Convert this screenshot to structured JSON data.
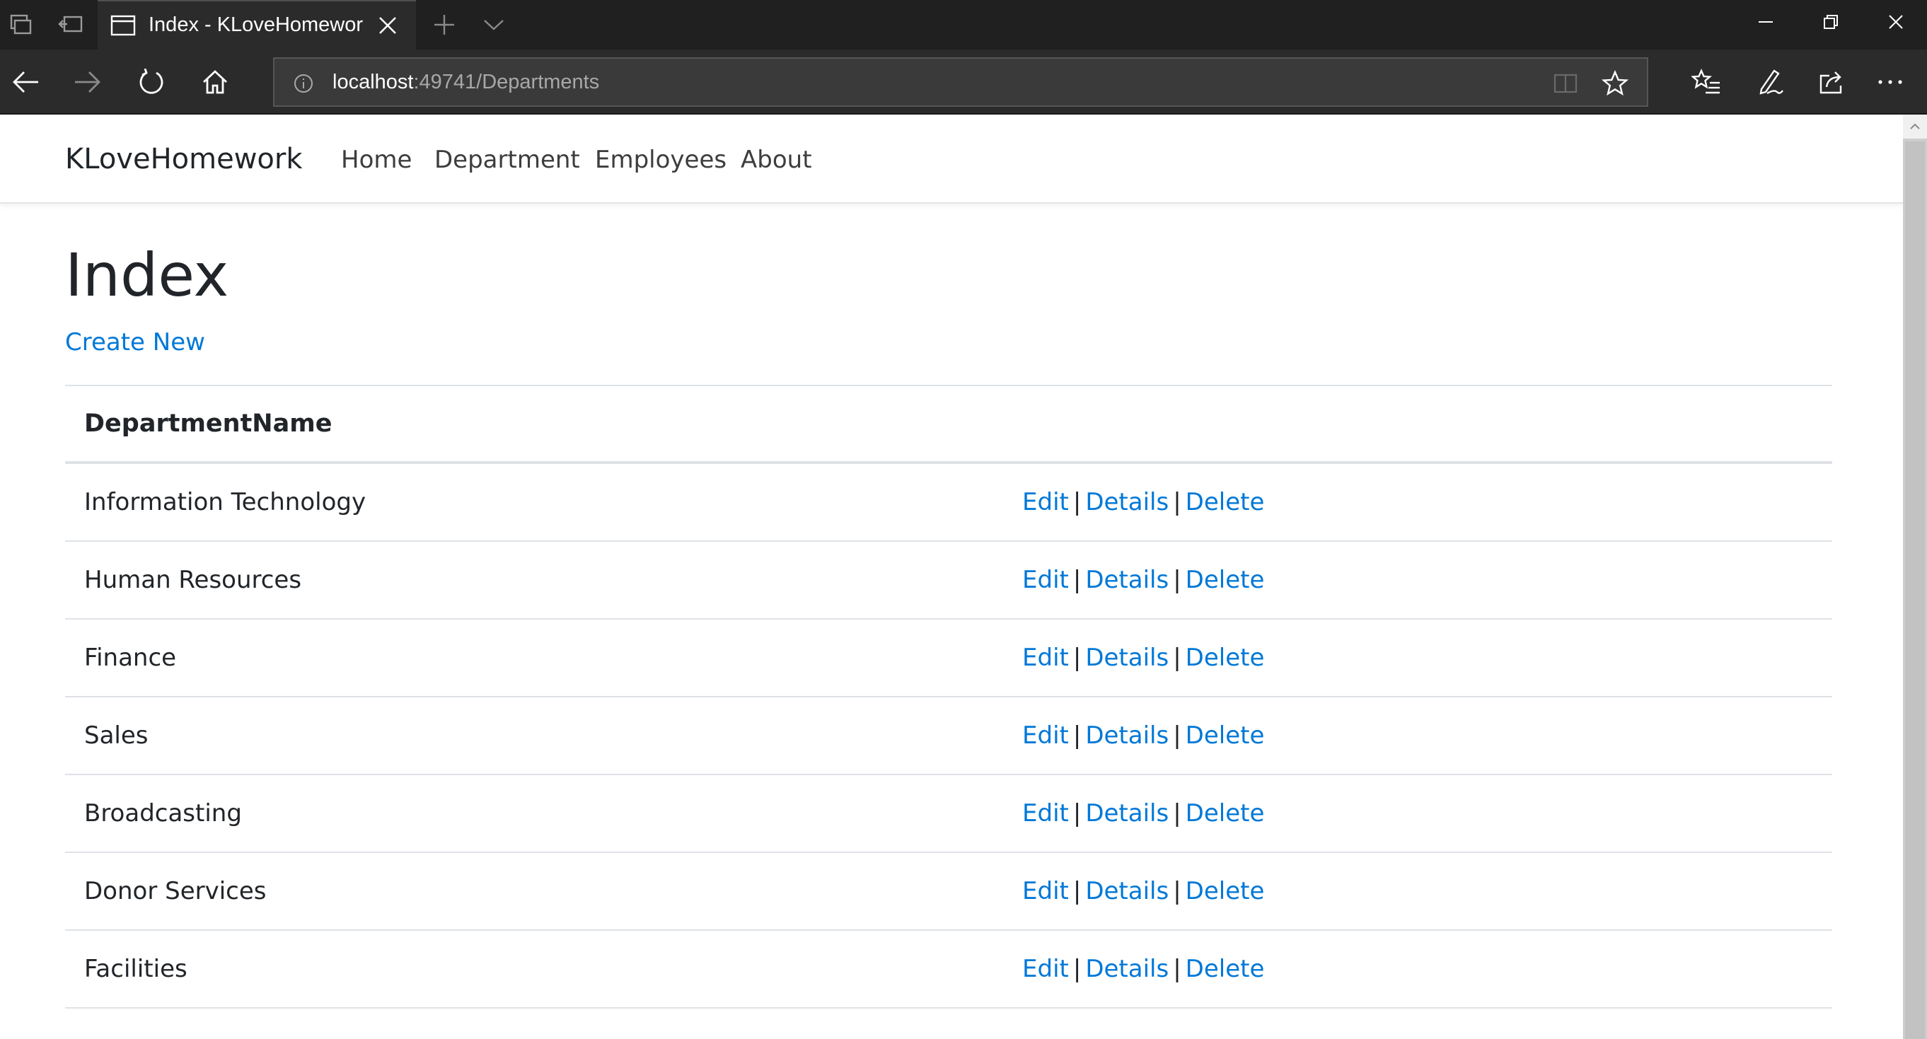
{
  "browser": {
    "tab_title": "Index - KLoveHomewor",
    "url_host": "localhost",
    "url_rest": ":49741/Departments"
  },
  "icons": {
    "tab_preview": "tab-preview-icon",
    "set_aside": "set-tabs-aside-icon",
    "page": "page-icon",
    "close_tab": "close-icon",
    "new_tab": "plus-icon",
    "tab_list": "chevron-down-icon",
    "minimize": "minimize-icon",
    "restore": "restore-icon",
    "close_window": "close-icon",
    "back": "back-arrow-icon",
    "forward": "forward-arrow-icon",
    "refresh": "refresh-icon",
    "home": "home-icon",
    "info": "info-icon",
    "reading_view": "reading-view-icon",
    "favorite": "star-icon",
    "favorites_hub": "favorites-list-icon",
    "web_note": "pen-icon",
    "share": "share-icon",
    "more": "more-icon"
  },
  "site": {
    "brand": "KLoveHomework",
    "nav": [
      "Home",
      "Department",
      "Employees",
      "About"
    ]
  },
  "main": {
    "title": "Index",
    "create_new": "Create New",
    "table": {
      "column_header": "DepartmentName",
      "actions": {
        "edit": "Edit",
        "details": "Details",
        "delete": "Delete",
        "separator": "|"
      },
      "rows": [
        "Information Technology",
        "Human Resources",
        "Finance",
        "Sales",
        "Broadcasting",
        "Donor Services",
        "Facilities"
      ]
    }
  },
  "colors": {
    "link": "#0078d7",
    "text": "#212529",
    "chrome_dark": "#202020",
    "toolbar": "#2b2b2b"
  }
}
